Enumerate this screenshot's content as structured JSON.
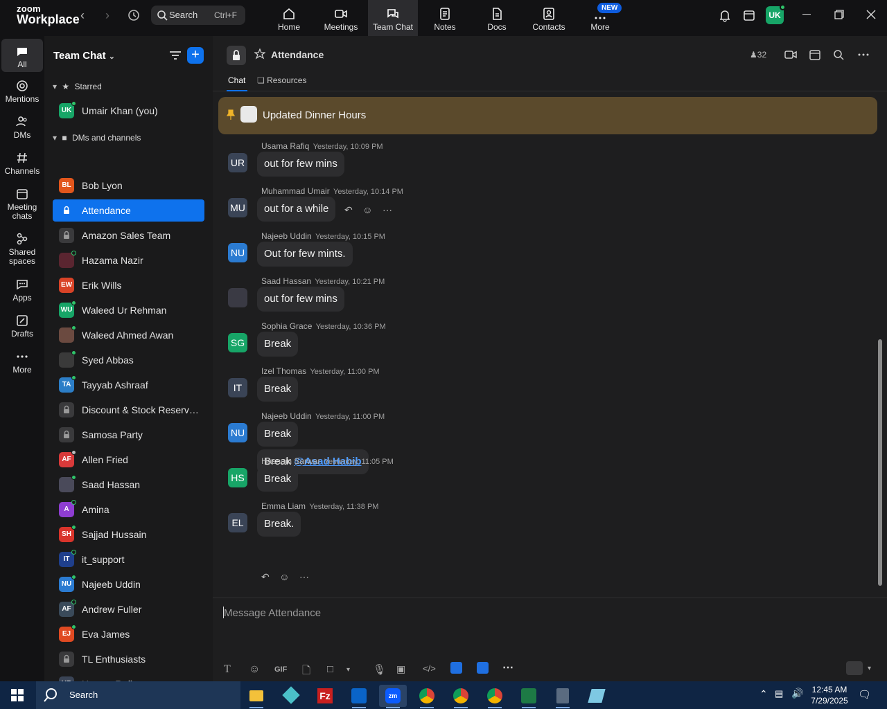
{
  "app": {
    "logo_line1": "zoom",
    "logo_line2": "Workplace",
    "search_label": "Search",
    "search_shortcut": "Ctrl+F",
    "user_initials": "UK",
    "new_badge": "NEW"
  },
  "topnav": [
    {
      "label": "Home"
    },
    {
      "label": "Meetings"
    },
    {
      "label": "Team Chat"
    },
    {
      "label": "Notes"
    },
    {
      "label": "Docs"
    },
    {
      "label": "Contacts"
    },
    {
      "label": "More"
    }
  ],
  "rail": [
    {
      "label": "All"
    },
    {
      "label": "Mentions"
    },
    {
      "label": "DMs"
    },
    {
      "label": "Channels"
    },
    {
      "label": "Meeting chats"
    },
    {
      "label": "Shared spaces"
    },
    {
      "label": "Apps"
    },
    {
      "label": "Drafts"
    },
    {
      "label": "More"
    }
  ],
  "sidebar": {
    "title": "Team Chat",
    "starred_label": "Starred",
    "dms_label": "DMs and channels",
    "starred": [
      {
        "name": "Umair Khan (you)",
        "initials": "UK",
        "color": "#17a567",
        "presence": "#2fc46a"
      }
    ],
    "items": [
      {
        "name": "Bob Lyon",
        "initials": "BL",
        "color": "#e2561c",
        "presence": ""
      },
      {
        "name": "Attendance",
        "type": "channel",
        "active": true
      },
      {
        "name": "Amazon Sales Team",
        "type": "channel"
      },
      {
        "name": "Hazama Nazir",
        "initials": "",
        "color": "#5a2530",
        "presence": "#1a1a1b"
      },
      {
        "name": "Erik Wills",
        "initials": "EW",
        "color": "#d94327",
        "presence": ""
      },
      {
        "name": "Waleed Ur Rehman",
        "initials": "WU",
        "color": "#17a567",
        "presence": "#2fc46a"
      },
      {
        "name": "Waleed Ahmed Awan",
        "initials": "",
        "color": "#6b4a40",
        "presence": "#2fc46a"
      },
      {
        "name": "Syed Abbas",
        "initials": "",
        "color": "#3a3a3a",
        "presence": "#2fc46a"
      },
      {
        "name": "Tayyab Ashraaf",
        "initials": "TA",
        "color": "#2c7ec7",
        "presence": "#2fc46a"
      },
      {
        "name": "Discount & Stock Reservati...",
        "type": "channel"
      },
      {
        "name": "Samosa Party",
        "type": "channel"
      },
      {
        "name": "Allen Fried",
        "initials": "AF",
        "color": "#d93a3a",
        "presence": "#bbbbbb"
      },
      {
        "name": "Saad Hassan",
        "initials": "",
        "color": "#4a4a5a",
        "presence": "#2fc46a"
      },
      {
        "name": "Amina",
        "initials": "A",
        "color": "#8e3dd1",
        "presence": "#1a1a1b"
      },
      {
        "name": "Sajjad Hussain",
        "initials": "SH",
        "color": "#d9342b",
        "presence": "#2fc46a"
      },
      {
        "name": "it_support",
        "initials": "IT",
        "color": "#1f3f8c",
        "presence": "#1a1a1b"
      },
      {
        "name": "Najeeb Uddin",
        "initials": "NU",
        "color": "#2b7bd1",
        "presence": "#2fc46a"
      },
      {
        "name": "Andrew Fuller",
        "initials": "AF",
        "color": "#3a4a5a",
        "presence": "#1a1a1b"
      },
      {
        "name": "Eva James",
        "initials": "EJ",
        "color": "#e04a22",
        "presence": "#2fc46a"
      },
      {
        "name": "TL Enthusiasts",
        "type": "channel"
      },
      {
        "name": "Usama Rafiq",
        "initials": "UR",
        "color": "#3a4456",
        "presence": ""
      }
    ]
  },
  "channel": {
    "name": "Attendance",
    "member_count": "32",
    "tab_chat": "Chat",
    "tab_resources": "Resources",
    "pinned": "Updated Dinner Hours",
    "composer_placeholder": "Message Attendance",
    "gif_label": "GIF"
  },
  "messages": [
    {
      "initials": "UR",
      "color": "#3a4456",
      "author": "Usama Rafiq",
      "time": "Yesterday, 10:09 PM",
      "text": "out for few mins"
    },
    {
      "initials": "MU",
      "color": "#3a4456",
      "author": "Muhammad Umair",
      "time": "Yesterday, 10:14 PM",
      "text": "out for a while"
    },
    {
      "initials": "NU",
      "color": "#2b7bd1",
      "author": "Najeeb Uddin",
      "time": "Yesterday, 10:15 PM",
      "text": "Out for few mints."
    },
    {
      "initials": "",
      "color": "#3a3a44",
      "author": "Saad Hassan",
      "time": "Yesterday, 10:21 PM",
      "text": "out for few mins"
    },
    {
      "initials": "SG",
      "color": "#17a567",
      "author": "Sophia Grace",
      "time": "Yesterday, 10:36 PM",
      "text": "Break"
    },
    {
      "initials": "IT",
      "color": "#3a4456",
      "author": "Izel Thomas",
      "time": "Yesterday, 11:00 PM",
      "text": "Break"
    },
    {
      "initials": "NU",
      "color": "#2b7bd1",
      "author": "Najeeb Uddin",
      "time": "Yesterday, 11:00 PM",
      "text": "Break",
      "extra_text": "Break",
      "extra_mention": "@Asad Habib"
    },
    {
      "initials": "HS",
      "color": "#17a567",
      "author": "Hasnain Sarwar",
      "time": "Yesterday, 11:05 PM",
      "text": "Break"
    },
    {
      "initials": "EL",
      "color": "#3a4456",
      "author": "Emma Liam",
      "time": "Yesterday, 11:38 PM",
      "text": "Break."
    }
  ],
  "taskbar": {
    "search_label": "Search",
    "time": "12:45 AM",
    "date": "7/29/2025"
  }
}
